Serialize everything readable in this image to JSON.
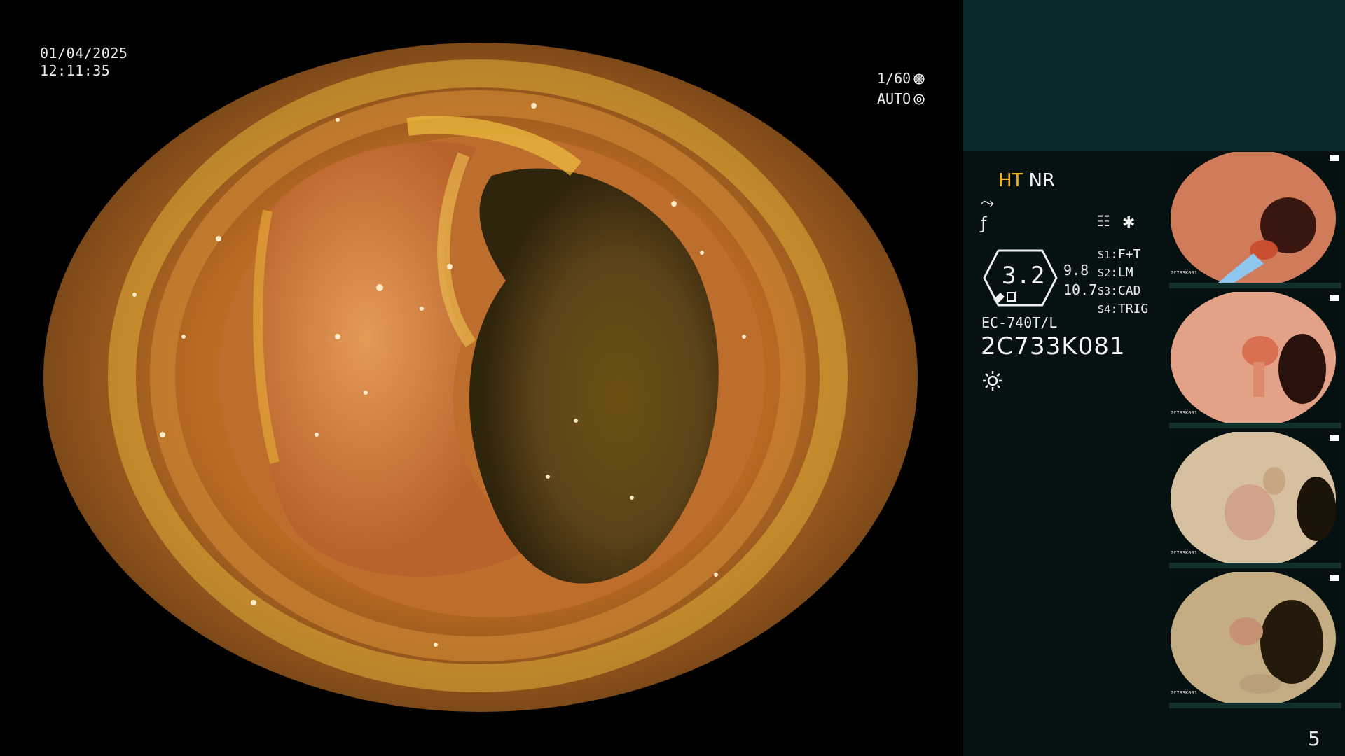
{
  "overlay": {
    "date": "01/04/2025",
    "time": "12:11:35",
    "shutter": "1/60",
    "iris": "AUTO"
  },
  "panel": {
    "mode_ht": "HT",
    "mode_nr": "NR",
    "gauge_value": "3.2",
    "side_values": [
      "9.8",
      "10.7"
    ],
    "settings": [
      {
        "key": "S1",
        "value": "F+T"
      },
      {
        "key": "S2",
        "value": "LM"
      },
      {
        "key": "S3",
        "value": "CAD"
      },
      {
        "key": "S4",
        "value": "TRIG"
      }
    ],
    "model": "EC-740T/L",
    "serial": "2C733K081",
    "page_number": "5"
  },
  "thumbnails": [
    {
      "label": "2C733K081"
    },
    {
      "label": "2C733K081"
    },
    {
      "label": "2C733K081"
    },
    {
      "label": "2C733K081"
    }
  ],
  "colors": {
    "accent": "#f7b21b",
    "panel_dark": "#061212",
    "panel_top": "#072b2b"
  }
}
